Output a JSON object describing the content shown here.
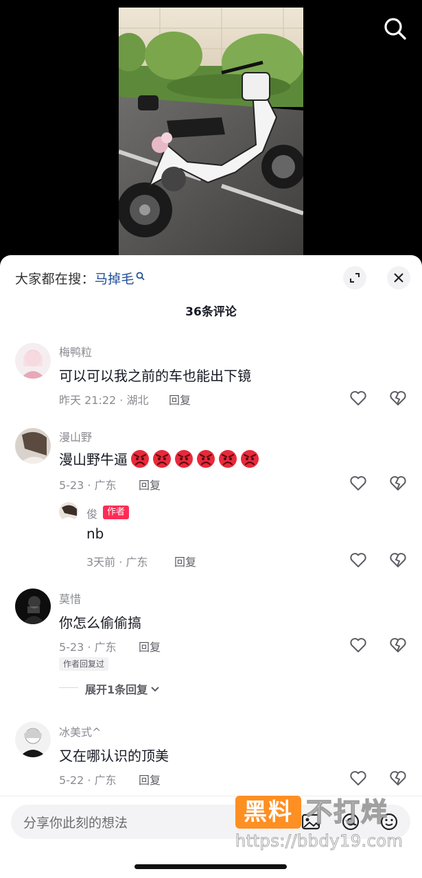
{
  "hot_search": {
    "label": "大家都在搜：",
    "keyword": "马掉毛"
  },
  "comment_count": "36条评论",
  "comments": [
    {
      "name": "梅鸭粒",
      "text": "可以可以我之前的车也能出下镜",
      "meta": "昨天 21:22 · 湖北",
      "reply": "回复"
    },
    {
      "name": "漫山野",
      "text": "漫山野牛逼",
      "emoji_count": 6,
      "emoji": "angry-face-icon",
      "meta": "5-23 · 广东",
      "reply": "回复",
      "sub_reply": {
        "name": "俊",
        "tag": "作者",
        "text": "nb",
        "meta": "3天前 · 广东",
        "reply": "回复"
      }
    },
    {
      "name": "莫惜",
      "text": "你怎么偷偷搞",
      "meta": "5-23 · 广东",
      "reply": "回复",
      "badge": "作者回复过",
      "expand": "展开1条回复"
    },
    {
      "name": "冰美式^",
      "text": "又在哪认识的顶美",
      "meta": "5-22 · 广东",
      "reply": "回复"
    }
  ],
  "input": {
    "placeholder": "分享你此刻的想法"
  },
  "watermark": {
    "badge": "黑料",
    "text": "不打烊",
    "url": "https://bbdy19.com"
  },
  "colors": {
    "accent": "#fe2c55",
    "keyword": "#1f4f96",
    "watermark": "#ff8a17"
  }
}
